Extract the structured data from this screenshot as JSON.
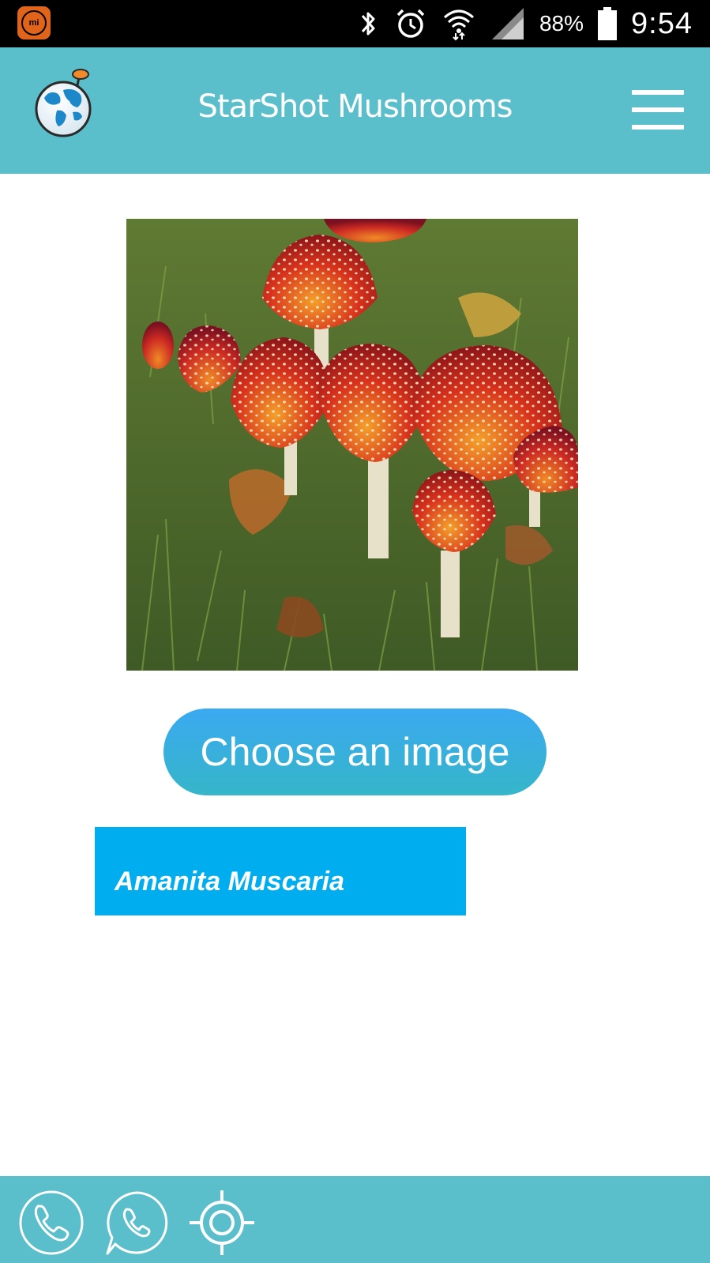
{
  "status_bar": {
    "app_badge": "mi",
    "battery_percent": "88%",
    "time": "9:54",
    "icons": [
      "bluetooth-icon",
      "alarm-icon",
      "wifi-icon",
      "signal-icon",
      "battery-icon"
    ]
  },
  "header": {
    "title": "StarShot Mushrooms",
    "logo_icon": "globe-logo-icon",
    "menu_icon": "hamburger-menu-icon"
  },
  "main": {
    "choose_button_label": "Choose an image",
    "result_label": "Amanita Muscaria"
  },
  "bottom_bar": {
    "icons": [
      "phone-icon",
      "whatsapp-icon",
      "location-target-icon"
    ]
  },
  "colors": {
    "header_bg": "#5abfcb",
    "button_gradient_top": "#3ba9f0",
    "button_gradient_bottom": "#35b6c9",
    "result_bg": "#00aeef"
  }
}
